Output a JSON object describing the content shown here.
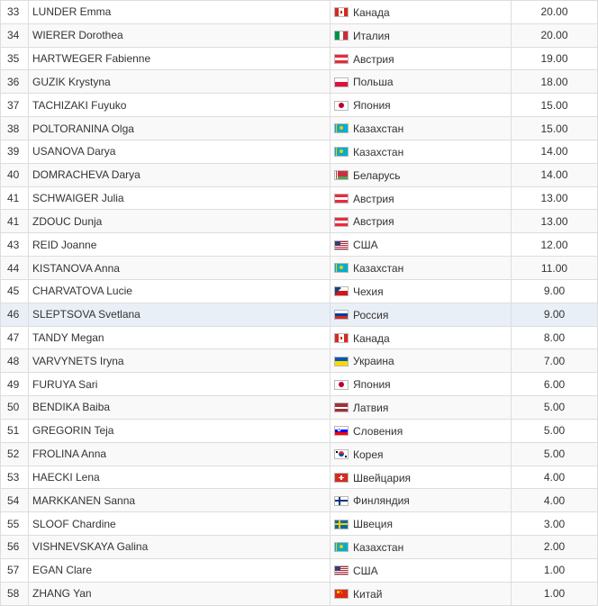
{
  "rows": [
    {
      "rank": "33",
      "name": "LUNDER Emma",
      "flag": "canada-flag-icon",
      "country": "Канада",
      "points": "20.00"
    },
    {
      "rank": "34",
      "name": "WIERER Dorothea",
      "flag": "italy-flag-icon",
      "country": "Италия",
      "points": "20.00"
    },
    {
      "rank": "35",
      "name": "HARTWEGER Fabienne",
      "flag": "austria-flag-icon",
      "country": "Австрия",
      "points": "19.00"
    },
    {
      "rank": "36",
      "name": "GUZIK Krystyna",
      "flag": "poland-flag-icon",
      "country": "Польша",
      "points": "18.00"
    },
    {
      "rank": "37",
      "name": "TACHIZAKI Fuyuko",
      "flag": "japan-flag-icon",
      "country": "Япония",
      "points": "15.00"
    },
    {
      "rank": "38",
      "name": "POLTORANINA Olga",
      "flag": "kazakhstan-flag-icon",
      "country": "Казахстан",
      "points": "15.00"
    },
    {
      "rank": "39",
      "name": "USANOVA Darya",
      "flag": "kazakhstan-flag-icon",
      "country": "Казахстан",
      "points": "14.00"
    },
    {
      "rank": "40",
      "name": "DOMRACHEVA Darya",
      "flag": "belarus-flag-icon",
      "country": "Беларусь",
      "points": "14.00"
    },
    {
      "rank": "41",
      "name": "SCHWAIGER Julia",
      "flag": "austria-flag-icon",
      "country": "Австрия",
      "points": "13.00"
    },
    {
      "rank": "41",
      "name": "ZDOUC Dunja",
      "flag": "austria-flag-icon",
      "country": "Австрия",
      "points": "13.00"
    },
    {
      "rank": "43",
      "name": "REID Joanne",
      "flag": "usa-flag-icon",
      "country": "США",
      "points": "12.00"
    },
    {
      "rank": "44",
      "name": "KISTANOVA Anna",
      "flag": "kazakhstan-flag-icon",
      "country": "Казахстан",
      "points": "11.00"
    },
    {
      "rank": "45",
      "name": "CHARVATOVA Lucie",
      "flag": "czech-flag-icon",
      "country": "Чехия",
      "points": "9.00"
    },
    {
      "rank": "46",
      "name": "SLEPTSOVA Svetlana",
      "flag": "russia-flag-icon",
      "country": "Россия",
      "points": "9.00",
      "highlight": true
    },
    {
      "rank": "47",
      "name": "TANDY Megan",
      "flag": "canada-flag-icon",
      "country": "Канада",
      "points": "8.00"
    },
    {
      "rank": "48",
      "name": "VARVYNETS Iryna",
      "flag": "ukraine-flag-icon",
      "country": "Украина",
      "points": "7.00"
    },
    {
      "rank": "49",
      "name": "FURUYA Sari",
      "flag": "japan-flag-icon",
      "country": "Япония",
      "points": "6.00"
    },
    {
      "rank": "50",
      "name": "BENDIKA Baiba",
      "flag": "latvia-flag-icon",
      "country": "Латвия",
      "points": "5.00"
    },
    {
      "rank": "51",
      "name": "GREGORIN Teja",
      "flag": "slovenia-flag-icon",
      "country": "Словения",
      "points": "5.00"
    },
    {
      "rank": "52",
      "name": "FROLINA Anna",
      "flag": "korea-flag-icon",
      "country": "Корея",
      "points": "5.00"
    },
    {
      "rank": "53",
      "name": "HAECKI Lena",
      "flag": "switzerland-flag-icon",
      "country": "Швейцария",
      "points": "4.00"
    },
    {
      "rank": "54",
      "name": "MARKKANEN Sanna",
      "flag": "finland-flag-icon",
      "country": "Финляндия",
      "points": "4.00"
    },
    {
      "rank": "55",
      "name": "SLOOF Chardine",
      "flag": "sweden-flag-icon",
      "country": "Швеция",
      "points": "3.00"
    },
    {
      "rank": "56",
      "name": "VISHNEVSKAYA Galina",
      "flag": "kazakhstan-flag-icon",
      "country": "Казахстан",
      "points": "2.00"
    },
    {
      "rank": "57",
      "name": "EGAN Clare",
      "flag": "usa-flag-icon",
      "country": "США",
      "points": "1.00"
    },
    {
      "rank": "58",
      "name": "ZHANG Yan",
      "flag": "china-flag-icon",
      "country": "Китай",
      "points": "1.00"
    }
  ],
  "colors": {
    "highlight_row": "#e9eff6",
    "stripe_row": "#f9f9f9",
    "border": "#dddddd",
    "text": "#333333"
  }
}
